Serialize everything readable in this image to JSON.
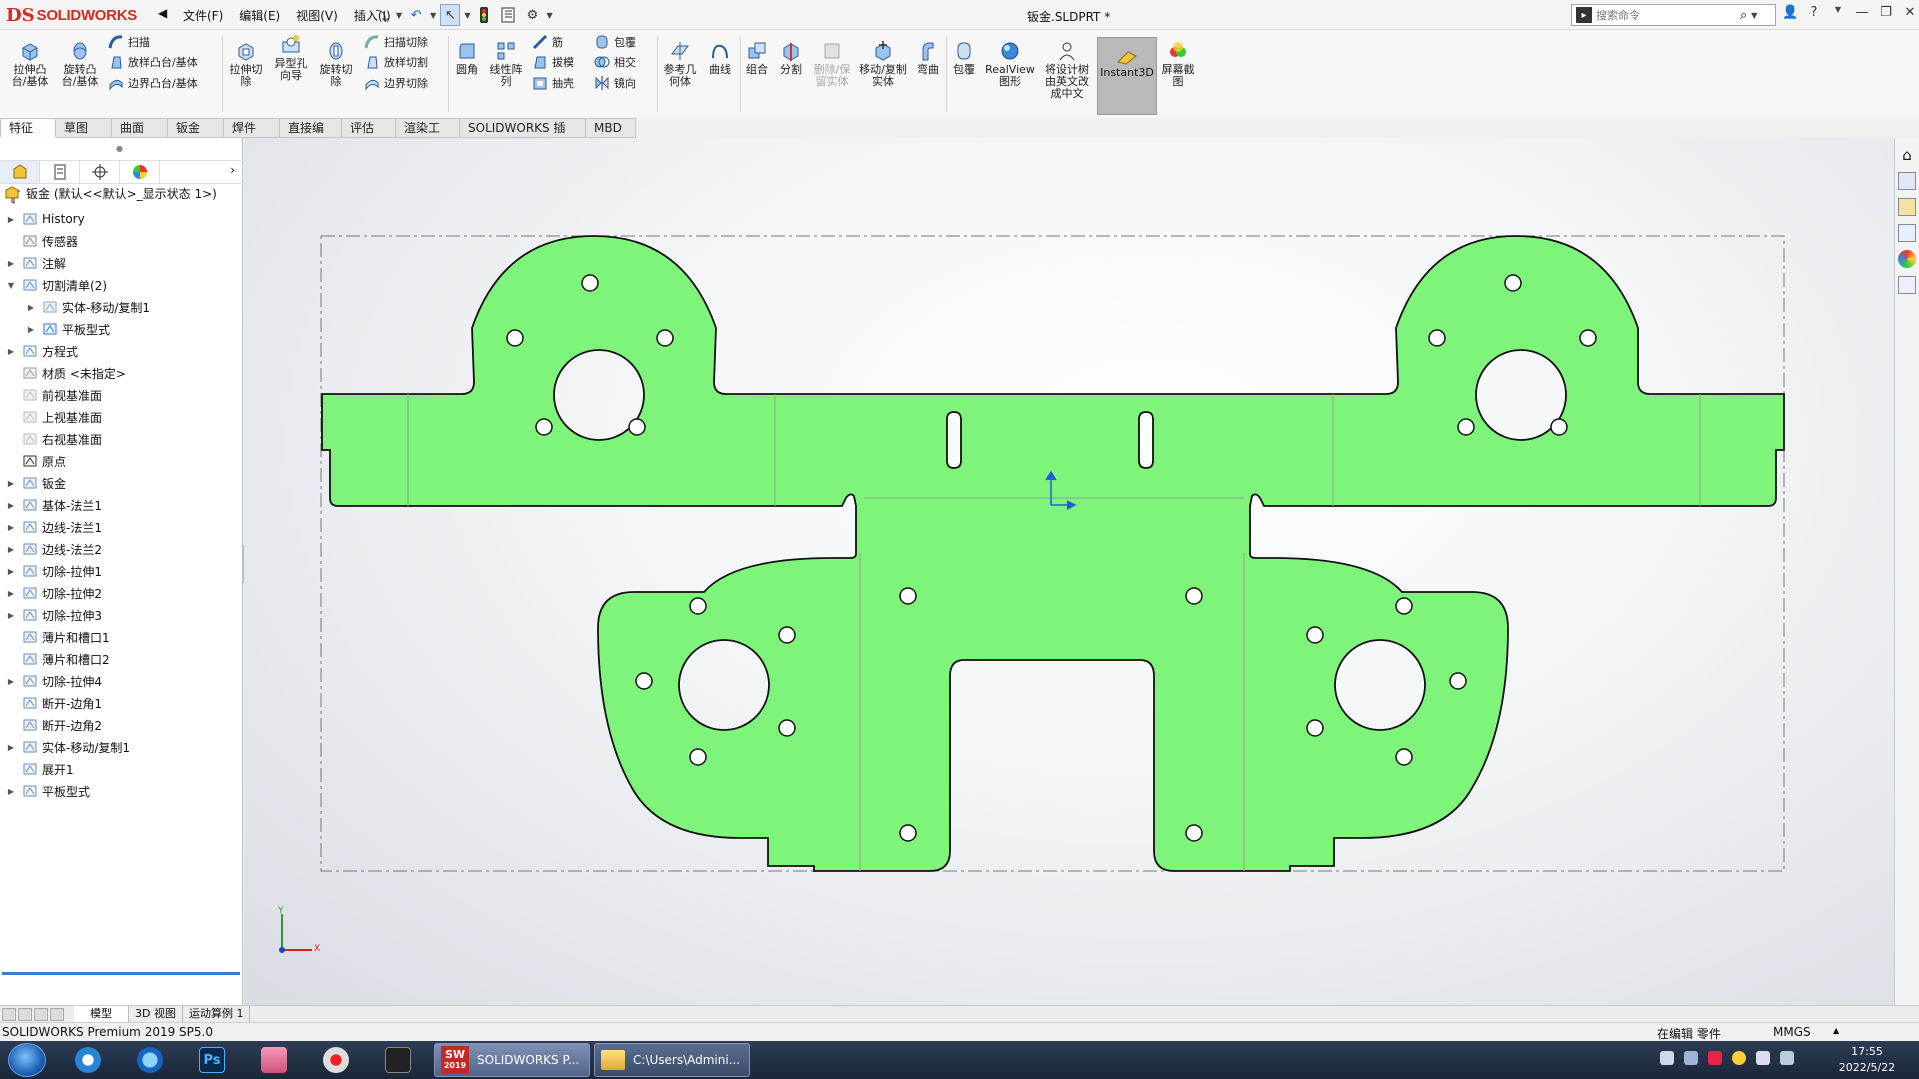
{
  "app": {
    "brand_ds": "DS",
    "brand_name": "SOLIDWORKS",
    "doc_title": "钣金.SLDPRT *",
    "menus": [
      "文件(F)",
      "编辑(E)",
      "视图(V)",
      "插入(I)"
    ],
    "search_placeholder": "搜索命令",
    "help_glyph": "?"
  },
  "commands": {
    "extrude_boss": "拉伸凸台/基体",
    "revolve_boss": "旋转凸台/基体",
    "sweep": "扫描",
    "loft": "放样凸台/基体",
    "boundary": "边界凸台/基体",
    "extrude_cut": "拉伸切除",
    "hole_wizard": "异型孔向导",
    "revolve_cut": "旋转切除",
    "swept_cut": "扫描切除",
    "lofted_cut": "放样切割",
    "boundary_cut": "边界切除",
    "fillet": "圆角",
    "linear_pattern": "线性阵列",
    "rib": "筋",
    "draft": "拔模",
    "shell": "抽壳",
    "wrap": "包覆",
    "intersect": "相交",
    "mirror": "镜向",
    "ref_geometry": "参考几何体",
    "curves": "曲线",
    "combine": "组合",
    "split": "分割",
    "delete_keep": "删除/保留实体",
    "move_copy": "移动/复制实体",
    "flex": "弯曲",
    "wrap2": "包覆",
    "realview": "RealView图形",
    "translate": "将设计树由英文改成中文",
    "instant3d": "Instant3D",
    "screenshot": "屏幕截图"
  },
  "tabs": [
    "特征",
    "草图",
    "曲面",
    "钣金",
    "焊件",
    "直接编辑",
    "评估",
    "渲染工具",
    "SOLIDWORKS 插件",
    "MBD"
  ],
  "tree": {
    "root": "钣金  (默认<<默认>_显示状态 1>)",
    "items": [
      {
        "label": "History",
        "level": 0,
        "expand": "▶"
      },
      {
        "label": "传感器",
        "level": 0,
        "expand": ""
      },
      {
        "label": "注解",
        "level": 0,
        "expand": "▶"
      },
      {
        "label": "切割清单(2)",
        "level": 0,
        "expand": "▼"
      },
      {
        "label": "实体-移动/复制1",
        "level": 1,
        "expand": "▶"
      },
      {
        "label": "平板型式",
        "level": 1,
        "expand": "▶"
      },
      {
        "label": "方程式",
        "level": 0,
        "expand": "▶"
      },
      {
        "label": "材质 <未指定>",
        "level": 0,
        "expand": ""
      },
      {
        "label": "前视基准面",
        "level": 0,
        "expand": ""
      },
      {
        "label": "上视基准面",
        "level": 0,
        "expand": ""
      },
      {
        "label": "右视基准面",
        "level": 0,
        "expand": ""
      },
      {
        "label": "原点",
        "level": 0,
        "expand": ""
      },
      {
        "label": "钣金",
        "level": 0,
        "expand": "▶"
      },
      {
        "label": "基体-法兰1",
        "level": 0,
        "expand": "▶"
      },
      {
        "label": "边线-法兰1",
        "level": 0,
        "expand": "▶"
      },
      {
        "label": "边线-法兰2",
        "level": 0,
        "expand": "▶"
      },
      {
        "label": "切除-拉伸1",
        "level": 0,
        "expand": "▶"
      },
      {
        "label": "切除-拉伸2",
        "level": 0,
        "expand": "▶"
      },
      {
        "label": "切除-拉伸3",
        "level": 0,
        "expand": "▶"
      },
      {
        "label": "薄片和槽口1",
        "level": 0,
        "expand": ""
      },
      {
        "label": "薄片和槽口2",
        "level": 0,
        "expand": ""
      },
      {
        "label": "切除-拉伸4",
        "level": 0,
        "expand": "▶"
      },
      {
        "label": "断开-边角1",
        "level": 0,
        "expand": ""
      },
      {
        "label": "断开-边角2",
        "level": 0,
        "expand": ""
      },
      {
        "label": "实体-移动/复制1",
        "level": 0,
        "expand": "▶"
      },
      {
        "label": "展开1",
        "level": 0,
        "expand": ""
      },
      {
        "label": "平板型式",
        "level": 0,
        "expand": "▶"
      }
    ]
  },
  "triad": {
    "y": "Y",
    "x": "X"
  },
  "bottom_tabs": [
    "模型",
    "3D 视图",
    "运动算例 1"
  ],
  "status": {
    "product": "SOLIDWORKS Premium 2019 SP5.0",
    "mode": "在编辑 零件",
    "units": "MMGS"
  },
  "taskbar": {
    "sw_window": "SOLIDWORKS P...",
    "sw_year": "2019",
    "ps_label": "Ps",
    "explorer_window": "C:\\Users\\Admini...",
    "time": "17:55",
    "date": "2022/5/22"
  },
  "colors": {
    "part_fill": "#7ef57a",
    "part_stroke": "#111111",
    "accent": "#d52b1e",
    "bbox_line": "#777777"
  }
}
